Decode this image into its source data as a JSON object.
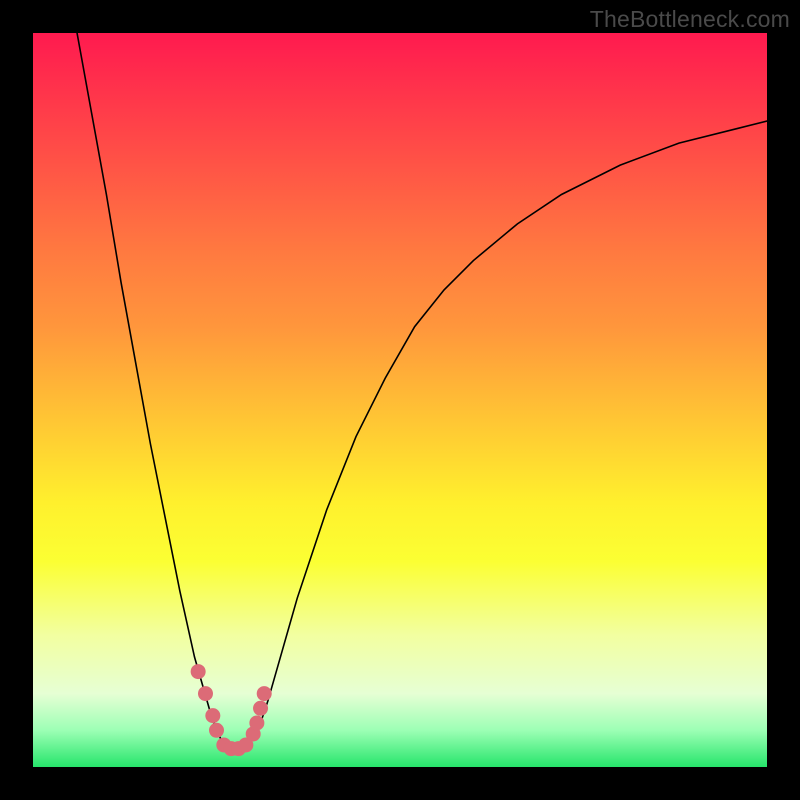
{
  "watermark": "TheBottleneck.com",
  "chart_data": {
    "type": "line",
    "title": "",
    "xlabel": "",
    "ylabel": "",
    "xlim": [
      0,
      100
    ],
    "ylim": [
      0,
      100
    ],
    "grid": false,
    "legend": false,
    "series": [
      {
        "name": "curve",
        "x": [
          6.0,
          8.0,
          10.0,
          12.0,
          14.0,
          16.0,
          18.0,
          20.0,
          22.0,
          24.0,
          25.0,
          26.0,
          27.0,
          28.0,
          29.0,
          30.0,
          31.0,
          32.0,
          34.0,
          36.0,
          38.0,
          40.0,
          44.0,
          48.0,
          52.0,
          56.0,
          60.0,
          66.0,
          72.0,
          80.0,
          88.0,
          96.0,
          100.0
        ],
        "y": [
          100.0,
          89.0,
          78.0,
          66.0,
          55.0,
          44.0,
          34.0,
          24.0,
          15.0,
          8.0,
          5.0,
          3.0,
          2.5,
          2.5,
          3.0,
          4.0,
          6.0,
          9.0,
          16.0,
          23.0,
          29.0,
          35.0,
          45.0,
          53.0,
          60.0,
          65.0,
          69.0,
          74.0,
          78.0,
          82.0,
          85.0,
          87.0,
          88.0
        ]
      }
    ],
    "highlight": {
      "name": "bottom-dots",
      "color": "#dc6b77",
      "x": [
        22.5,
        23.5,
        24.5,
        25.0,
        26.0,
        27.0,
        28.0,
        29.0,
        30.0,
        30.5,
        31.0,
        31.5
      ],
      "y": [
        13.0,
        10.0,
        7.0,
        5.0,
        3.0,
        2.5,
        2.5,
        3.0,
        4.5,
        6.0,
        8.0,
        10.0
      ]
    }
  }
}
